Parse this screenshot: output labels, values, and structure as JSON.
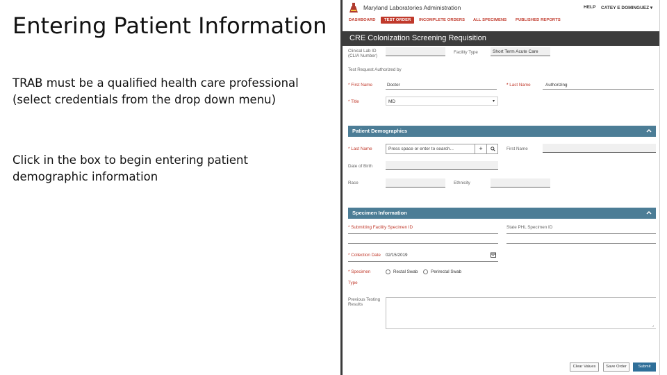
{
  "slide": {
    "title": "Entering Patient Information",
    "text1_line1": "TRAB must be a qualified health care professional",
    "text1_line2": "(select credentials from the drop down menu)",
    "text2_line1": "Click in the box to begin entering patient",
    "text2_line2": "demographic information"
  },
  "app": {
    "name": "Maryland Laboratories Administration",
    "help": "HELP",
    "user": "CATEY E DOMINGUEZ ▾",
    "nav": [
      "DASHBOARD",
      "TEST ORDER",
      "INCOMPLETE ORDERS",
      "ALL SPECIMENS",
      "PUBLISHED REPORTS"
    ],
    "active_nav": "TEST ORDER",
    "form_title": "CRE Colonization Screening Requisition",
    "clinical_lab_id_label_1": "Clinical Lab ID",
    "clinical_lab_id_label_2": "(CLIA Number)",
    "facility_type_label": "Facility Type",
    "facility_type_value": "Short Term Acute Care",
    "trab_label": "Test Request Authorized by",
    "first_name_label": "First Name",
    "first_name_value": "Doctor",
    "last_name_label": "Last Name",
    "last_name_value": "Authorizing",
    "title_label": "Title",
    "title_value": "MD",
    "accent_color": "#c0392b",
    "section_color": "#4c7d96"
  },
  "demographics": {
    "header": "Patient Demographics",
    "last_name_label": "Last Name",
    "search_placeholder": "Press space or enter to search...",
    "add_icon": "plus-icon",
    "search_icon": "magnifier-icon",
    "first_name_label": "First Name",
    "dob_label": "Date of Birth",
    "race_label": "Race",
    "ethnicity_label": "Ethnicity"
  },
  "specimen": {
    "header": "Specimen Information",
    "submitting_id_label": "Submitting Facility Specimen ID",
    "lab_id_label": "State PHL Specimen ID",
    "collection_date_label": "Collection Date",
    "collection_date_value": "02/15/2019",
    "specimen_label": "Specimen",
    "type_label": "Type",
    "option_rectal": "Rectal Swab",
    "option_perirectal": "Perirectal Swab",
    "previous_testing_label_1": "Previous Testing",
    "previous_testing_label_2": "Results"
  },
  "buttons": {
    "clear": "Clear Values",
    "save": "Save Order",
    "submit": "Submit"
  }
}
